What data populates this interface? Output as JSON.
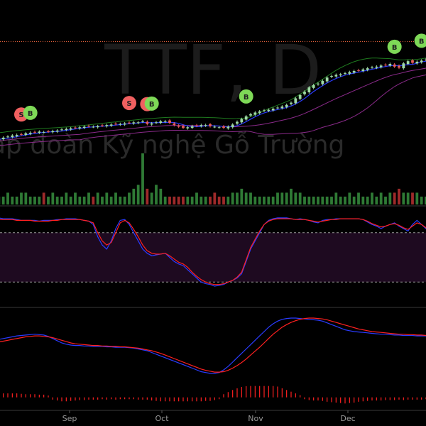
{
  "watermark": {
    "symbol": "TTF, D",
    "company": "ap đoàn Kỹ nghệ Gỗ Trường"
  },
  "colors": {
    "background": "#000000",
    "up_candle": "#9fd9a6",
    "down_candle": "#e85c5c",
    "bb_upper": "#1f7a1f",
    "bb_lower": "#8a2a8a",
    "ma_blue": "#2a3bff",
    "reference_line": "#e0603a",
    "stoch_band": "#1e0a20",
    "k_line": "#2a3bff",
    "d_line": "#ff2020",
    "macd_line": "#2a3bff",
    "signal_line": "#ff2020",
    "histogram": "#ff2020",
    "buy_marker": "#7ed957",
    "sell_marker": "#f06060",
    "axis_text": "#9a9a9a"
  },
  "x_axis": {
    "months": [
      "Sep",
      "Oct",
      "Nov",
      "Dec"
    ]
  },
  "chart_data": [
    {
      "type": "candlestick",
      "name": "price",
      "reference_level": 36.6,
      "ylim": [
        13,
        39
      ],
      "close": [
        18.6,
        18.8,
        19.0,
        19.2,
        19.4,
        19.5,
        19.6,
        19.8,
        19.9,
        20.0,
        20.1,
        20.0,
        20.1,
        20.2,
        20.3,
        20.5,
        20.6,
        20.7,
        20.8,
        20.9,
        21.0,
        21.1,
        21.0,
        21.1,
        21.2,
        21.3,
        21.4,
        21.5,
        21.5,
        21.6,
        21.7,
        21.8,
        21.8,
        22.0,
        21.5,
        21.6,
        21.8,
        22.0,
        22.0,
        21.7,
        21.3,
        21.0,
        20.8,
        20.9,
        21.1,
        21.2,
        21.3,
        21.3,
        21.1,
        21.0,
        20.9,
        20.8,
        21.0,
        21.4,
        21.9,
        22.4,
        22.9,
        23.3,
        23.6,
        23.8,
        24.0,
        24.1,
        24.3,
        24.5,
        24.7,
        25.0,
        25.4,
        26.2,
        26.8,
        27.4,
        28.2,
        28.6,
        28.9,
        29.4,
        30.0,
        30.3,
        30.5,
        30.6,
        30.8,
        31.0,
        31.2,
        31.3,
        31.5,
        31.7,
        31.9,
        32.0,
        32.2,
        32.3,
        32.5,
        32.0,
        31.8,
        32.6,
        33.0,
        32.7,
        32.9,
        33.1,
        33.3
      ],
      "volume": [
        3,
        2,
        2,
        3,
        2,
        2,
        3,
        3,
        2,
        2,
        2,
        3,
        2,
        3,
        2,
        2,
        3,
        2,
        3,
        2,
        2,
        3,
        2,
        3,
        2,
        3,
        2,
        3,
        2,
        2,
        3,
        4,
        5,
        13,
        4,
        3,
        5,
        4,
        2,
        2,
        2,
        2,
        2,
        2,
        2,
        3,
        2,
        2,
        2,
        3,
        2,
        2,
        2,
        3,
        3,
        4,
        3,
        3,
        2,
        2,
        2,
        2,
        2,
        3,
        3,
        3,
        4,
        3,
        3,
        2,
        2,
        2,
        2,
        2,
        2,
        2,
        3,
        2,
        2,
        3,
        2,
        3,
        2,
        2,
        3,
        2,
        3,
        2,
        3,
        3,
        4,
        3,
        3,
        3,
        3,
        2,
        2
      ]
    },
    {
      "type": "line",
      "name": "stochastic",
      "ylim": [
        -10,
        110
      ],
      "overbought": 80,
      "oversold": 20,
      "series": [
        {
          "key": "k",
          "values": [
            98,
            98,
            97,
            97,
            97,
            96,
            95,
            95,
            95,
            95,
            94,
            95,
            95,
            95,
            96,
            96,
            97,
            97,
            97,
            96,
            95,
            94,
            90,
            75,
            65,
            60,
            70,
            85,
            95,
            96,
            90,
            80,
            70,
            60,
            55,
            52,
            53,
            54,
            55,
            50,
            45,
            42,
            40,
            35,
            30,
            25,
            20,
            18,
            17,
            15,
            16,
            17,
            20,
            22,
            25,
            30,
            45,
            60,
            70,
            80,
            90,
            95,
            97,
            98,
            98,
            98,
            97,
            96,
            97,
            96,
            95,
            93,
            92,
            95,
            96,
            96,
            97,
            97,
            97,
            97,
            97,
            97,
            96,
            93,
            90,
            88,
            85,
            88,
            90,
            92,
            88,
            85,
            82,
            90,
            95,
            90,
            85,
            80,
            80
          ]
        },
        {
          "key": "d",
          "values": [
            96,
            96,
            96,
            96,
            96,
            95,
            95,
            95,
            95,
            94,
            94,
            94,
            94,
            95,
            95,
            96,
            96,
            96,
            96,
            96,
            95,
            94,
            92,
            80,
            70,
            65,
            68,
            80,
            92,
            95,
            92,
            84,
            75,
            65,
            58,
            55,
            54,
            54,
            55,
            52,
            48,
            44,
            42,
            38,
            32,
            27,
            23,
            20,
            18,
            17,
            17,
            18,
            20,
            22,
            26,
            32,
            47,
            62,
            72,
            82,
            90,
            94,
            96,
            97,
            97,
            97,
            97,
            96,
            96,
            96,
            95,
            94,
            93,
            94,
            95,
            96,
            96,
            97,
            97,
            97,
            97,
            97,
            96,
            94,
            91,
            89,
            87,
            88,
            90,
            91,
            89,
            86,
            84,
            88,
            92,
            90,
            86,
            82,
            82
          ]
        }
      ]
    },
    {
      "type": "line",
      "name": "macd",
      "ylim": [
        -1.2,
        1.0
      ],
      "series": [
        {
          "key": "macd",
          "values": [
            0.35,
            0.38,
            0.4,
            0.42,
            0.44,
            0.46,
            0.47,
            0.48,
            0.49,
            0.5,
            0.49,
            0.48,
            0.45,
            0.4,
            0.35,
            0.3,
            0.27,
            0.25,
            0.24,
            0.24,
            0.23,
            0.23,
            0.22,
            0.22,
            0.22,
            0.21,
            0.21,
            0.2,
            0.2,
            0.2,
            0.19,
            0.18,
            0.16,
            0.14,
            0.12,
            0.08,
            0.04,
            0.0,
            -0.04,
            -0.08,
            -0.12,
            -0.16,
            -0.2,
            -0.24,
            -0.28,
            -0.32,
            -0.36,
            -0.38,
            -0.4,
            -0.4,
            -0.38,
            -0.32,
            -0.24,
            -0.14,
            -0.04,
            0.06,
            0.16,
            0.26,
            0.36,
            0.46,
            0.56,
            0.66,
            0.74,
            0.8,
            0.84,
            0.86,
            0.87,
            0.87,
            0.86,
            0.85,
            0.84,
            0.83,
            0.82,
            0.8,
            0.76,
            0.72,
            0.68,
            0.64,
            0.6,
            0.58,
            0.56,
            0.55,
            0.54,
            0.53,
            0.52,
            0.51,
            0.5,
            0.5,
            0.49,
            0.48,
            0.48,
            0.47,
            0.47,
            0.47,
            0.46,
            0.46,
            0.46
          ]
        },
        {
          "key": "signal",
          "values": [
            0.3,
            0.32,
            0.34,
            0.36,
            0.38,
            0.4,
            0.42,
            0.44,
            0.45,
            0.46,
            0.46,
            0.45,
            0.44,
            0.42,
            0.39,
            0.36,
            0.33,
            0.3,
            0.28,
            0.27,
            0.26,
            0.25,
            0.24,
            0.24,
            0.23,
            0.23,
            0.22,
            0.22,
            0.21,
            0.21,
            0.2,
            0.19,
            0.18,
            0.16,
            0.14,
            0.12,
            0.09,
            0.06,
            0.02,
            -0.02,
            -0.06,
            -0.1,
            -0.14,
            -0.18,
            -0.22,
            -0.26,
            -0.3,
            -0.33,
            -0.35,
            -0.37,
            -0.37,
            -0.36,
            -0.33,
            -0.28,
            -0.22,
            -0.15,
            -0.07,
            0.02,
            0.11,
            0.2,
            0.3,
            0.4,
            0.5,
            0.58,
            0.66,
            0.72,
            0.77,
            0.81,
            0.84,
            0.86,
            0.87,
            0.87,
            0.86,
            0.85,
            0.83,
            0.8,
            0.77,
            0.74,
            0.71,
            0.68,
            0.65,
            0.62,
            0.6,
            0.58,
            0.56,
            0.55,
            0.54,
            0.53,
            0.52,
            0.51,
            0.5,
            0.5,
            0.49,
            0.49,
            0.48,
            0.48,
            0.47
          ]
        }
      ]
    }
  ],
  "signals": [
    {
      "type": "sell",
      "label": "S",
      "bar": 8
    },
    {
      "type": "buy",
      "label": "B",
      "bar": 11
    },
    {
      "type": "sell",
      "label": "S",
      "bar": 43
    },
    {
      "type": "sell",
      "label": "S",
      "bar": 48
    },
    {
      "type": "buy",
      "label": "B",
      "bar": 49
    },
    {
      "type": "buy",
      "label": "B",
      "bar": 80
    },
    {
      "type": "buy",
      "label": "B",
      "bar": 126
    },
    {
      "type": "buy",
      "label": "B",
      "bar": 134
    }
  ]
}
